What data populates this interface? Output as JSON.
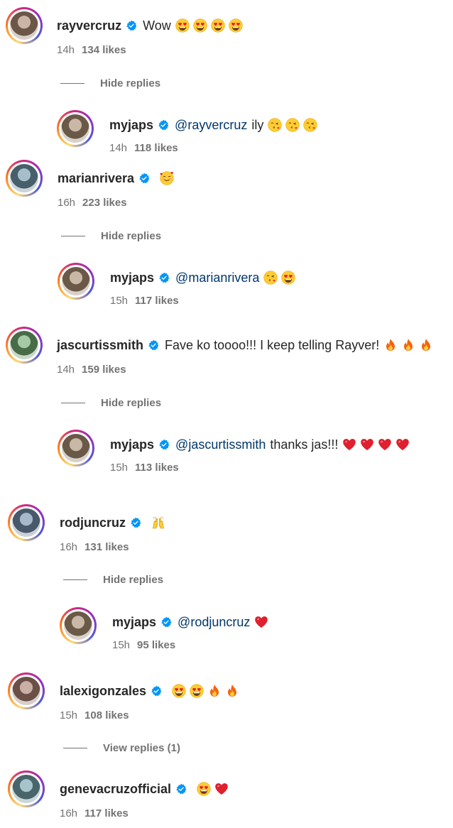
{
  "comments": [
    {
      "user": "rayvercruz",
      "text": "Wow",
      "emojis": [
        "heart-eyes",
        "heart-eyes",
        "heart-eyes",
        "heart-eyes"
      ],
      "time": "14h",
      "likes": "134 likes",
      "toggle": "Hide replies",
      "reply": {
        "user": "myjaps",
        "mention": "@rayvercruz",
        "text": "ily",
        "emojis": [
          "kiss",
          "kiss",
          "kiss"
        ],
        "time": "14h",
        "likes": "118 likes"
      }
    },
    {
      "user": "marianrivera",
      "text": "",
      "emojis": [
        "hearts-face"
      ],
      "time": "16h",
      "likes": "223 likes",
      "toggle": "Hide replies",
      "reply": {
        "user": "myjaps",
        "mention": "@marianrivera",
        "text": "",
        "emojis": [
          "kiss",
          "heart-eyes"
        ],
        "time": "15h",
        "likes": "117 likes"
      }
    },
    {
      "user": "jascurtissmith",
      "text": "Fave ko toooo!!! I keep telling Rayver!",
      "emojis": [
        "fire",
        "fire",
        "fire"
      ],
      "time": "14h",
      "likes": "159 likes",
      "toggle": "Hide replies",
      "reply": {
        "user": "myjaps",
        "mention": "@jascurtissmith",
        "text": "thanks jas!!!",
        "emojis": [
          "red-heart",
          "red-heart",
          "red-heart",
          "red-heart"
        ],
        "time": "15h",
        "likes": "113 likes"
      }
    },
    {
      "user": "rodjuncruz",
      "text": "",
      "emojis": [
        "raising-hands"
      ],
      "time": "16h",
      "likes": "131 likes",
      "toggle": "Hide replies",
      "reply": {
        "user": "myjaps",
        "mention": "@rodjuncruz",
        "text": "",
        "emojis": [
          "red-heart"
        ],
        "time": "15h",
        "likes": "95 likes"
      }
    },
    {
      "user": "lalexigonzales",
      "text": "",
      "emojis": [
        "heart-eyes",
        "heart-eyes",
        "fire",
        "fire"
      ],
      "time": "15h",
      "likes": "108 likes",
      "toggle": "View replies (1)"
    },
    {
      "user": "genevacruzofficial",
      "text": "",
      "emojis": [
        "heart-eyes",
        "red-heart"
      ],
      "time": "16h",
      "likes": "117 likes"
    }
  ],
  "colors": {
    "username": "#262626",
    "mention": "#00376b",
    "meta": "#737373",
    "verified": "#0095f6"
  }
}
